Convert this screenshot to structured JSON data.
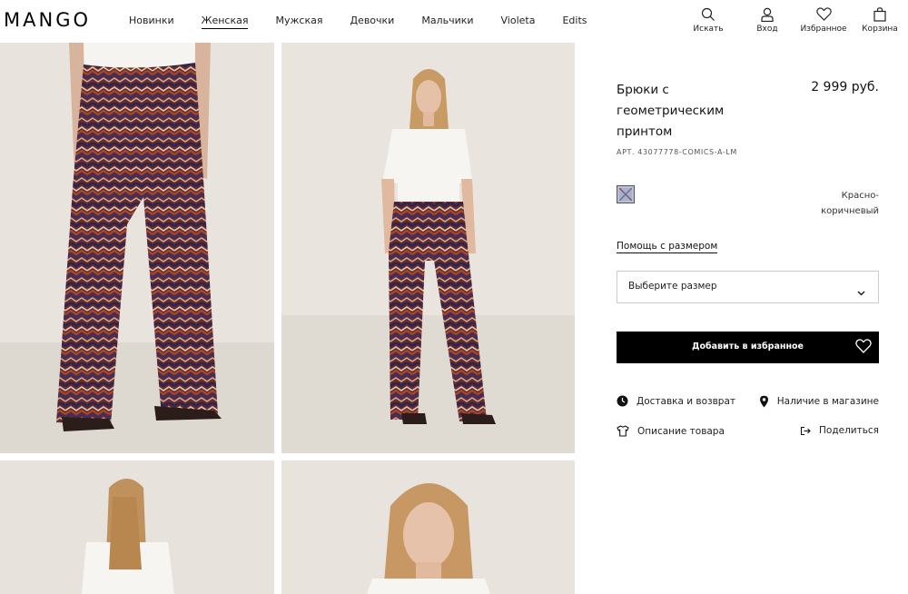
{
  "brand": "MANGO",
  "nav": {
    "items": [
      {
        "label": "Новинки",
        "active": false
      },
      {
        "label": "Женская",
        "active": true
      },
      {
        "label": "Мужская",
        "active": false
      },
      {
        "label": "Девочки",
        "active": false
      },
      {
        "label": "Мальчики",
        "active": false
      },
      {
        "label": "Violeta",
        "active": false
      },
      {
        "label": "Edits",
        "active": false
      }
    ]
  },
  "actions": {
    "search": "Искать",
    "login": "Вход",
    "favorites": "Избранное",
    "cart": "Корзина"
  },
  "product": {
    "title": "Брюки с геометрическим принтом",
    "price": "2 999 руб.",
    "article": "АРТ. 43077778-COMICS-A-LM",
    "color_name": "Красно-коричневый",
    "size_help": "Помощь с размером",
    "size_placeholder": "Выберите размер",
    "add_favorite": "Добавить в избранное"
  },
  "links": {
    "delivery": "Доставка и возврат",
    "in_store": "Наличие в магазине",
    "description": "Описание товара",
    "share": "Поделиться"
  },
  "colors": {
    "accent": "#000000",
    "background": "#ffffff"
  }
}
